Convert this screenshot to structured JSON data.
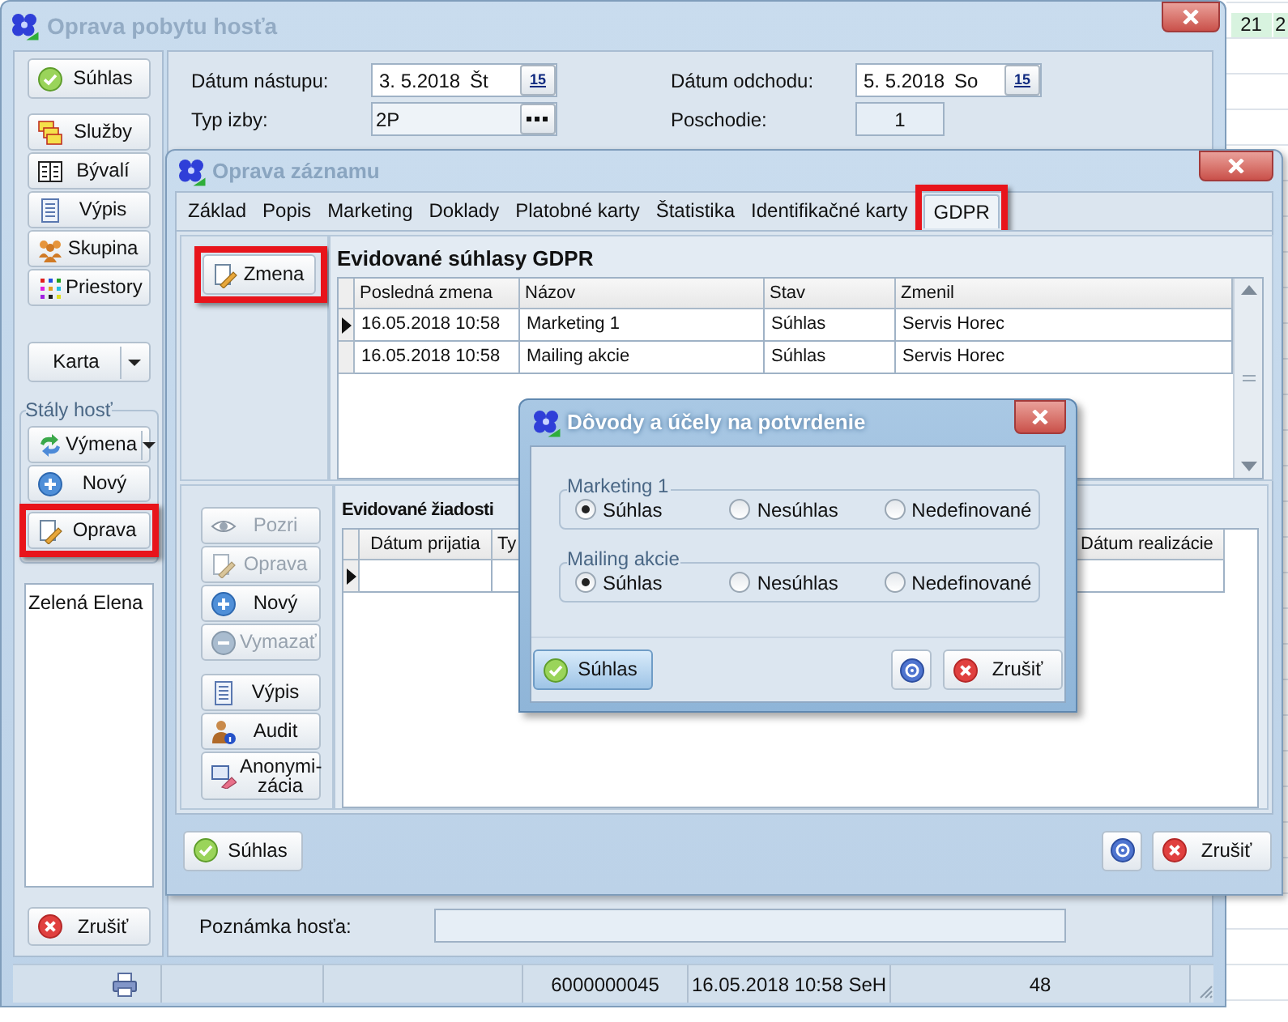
{
  "main_window": {
    "title": "Oprava pobytu hosťa",
    "sidebar": {
      "confirm": {
        "label": "Súhlas"
      },
      "buttons": [
        {
          "label": "Služby"
        },
        {
          "label": "Bývalí"
        },
        {
          "label": "Výpis"
        },
        {
          "label": "Skupina"
        },
        {
          "label": "Priestory"
        }
      ],
      "card": {
        "label": "Karta"
      },
      "group": {
        "title": "Stály hosť",
        "buttons": [
          {
            "label": "Výmena",
            "kind": "split",
            "highlighted": false
          },
          {
            "label": "Nový",
            "kind": "plain",
            "highlighted": false
          },
          {
            "label": "Oprava",
            "kind": "plain",
            "highlighted": true
          }
        ]
      },
      "guests": [
        "Zelená Elena"
      ],
      "cancel": {
        "label": "Zrušiť"
      }
    },
    "fields": [
      {
        "label": "Dátum nástupu:",
        "value": "3. 5.2018",
        "day": "Št",
        "button": "15",
        "kind": "date"
      },
      {
        "label": "Dátum odchodu:",
        "value": "5. 5.2018",
        "day": "So",
        "button": "15",
        "kind": "date"
      },
      {
        "label": "Typ izby:",
        "value": "2P",
        "kind": "lookup"
      },
      {
        "label": "Poschodie:",
        "value": "1",
        "kind": "readonly"
      }
    ],
    "note": {
      "label": "Poznámka hosťa:"
    },
    "status_bar": [
      "6000000045",
      "16.05.2018 10:58 SeH",
      "48"
    ]
  },
  "calendar": {
    "header": [
      "21",
      "2"
    ]
  },
  "record_window": {
    "title": "Oprava záznamu",
    "tabs": [
      {
        "label": "Základ",
        "selected": false,
        "highlighted": false
      },
      {
        "label": "Popis",
        "selected": false,
        "highlighted": false
      },
      {
        "label": "Marketing",
        "selected": false,
        "highlighted": false
      },
      {
        "label": "Doklady",
        "selected": false,
        "highlighted": false
      },
      {
        "label": "Platobné karty",
        "selected": false,
        "highlighted": false
      },
      {
        "label": "Štatistika",
        "selected": false,
        "highlighted": false
      },
      {
        "label": "Identifikačné karty",
        "selected": false,
        "highlighted": false
      },
      {
        "label": "GDPR",
        "selected": true,
        "highlighted": true
      }
    ],
    "consents": {
      "title": "Evidované súhlasy GDPR",
      "edit_button": {
        "label": "Zmena",
        "highlighted": true
      },
      "columns": [
        "Posledná zmena",
        "Názov",
        "Stav",
        "Zmenil"
      ],
      "rows": [
        {
          "cells": [
            "16.05.2018 10:58",
            "Marketing 1",
            "Súhlas",
            "Servis Horec"
          ],
          "current": true
        },
        {
          "cells": [
            "16.05.2018 10:58",
            "Mailing akcie",
            "Súhlas",
            "Servis Horec"
          ],
          "current": false
        }
      ]
    },
    "requests": {
      "title": "Evidované žiadosti",
      "buttons": [
        {
          "label": "Pozri",
          "disabled": true
        },
        {
          "label": "Oprava",
          "disabled": true
        },
        {
          "label": "Nový",
          "disabled": false
        },
        {
          "label": "Vymazať",
          "disabled": true
        },
        {
          "label": "Výpis",
          "disabled": false
        },
        {
          "label": "Audit",
          "disabled": false
        },
        {
          "label": "Anonymi-zácia",
          "disabled": false
        }
      ],
      "columns": [
        "Dátum prijatia",
        "Ty",
        "Dátum realizácie"
      ],
      "rows": [
        {
          "current": true
        }
      ]
    },
    "footer": {
      "confirm": "Súhlas",
      "cancel": "Zrušiť"
    }
  },
  "dialog": {
    "title": "Dôvody a účely na potvrdenie",
    "groups": [
      {
        "title": "Marketing 1",
        "options": [
          {
            "label": "Súhlas",
            "selected": true
          },
          {
            "label": "Nesúhlas",
            "selected": false
          },
          {
            "label": "Nedefinované",
            "selected": false
          }
        ]
      },
      {
        "title": "Mailing akcie",
        "options": [
          {
            "label": "Súhlas",
            "selected": true
          },
          {
            "label": "Nesúhlas",
            "selected": false
          },
          {
            "label": "Nedefinované",
            "selected": false
          }
        ]
      }
    ],
    "confirm": {
      "label": "Súhlas",
      "focused": true
    },
    "cancel": {
      "label": "Zrušiť"
    }
  }
}
